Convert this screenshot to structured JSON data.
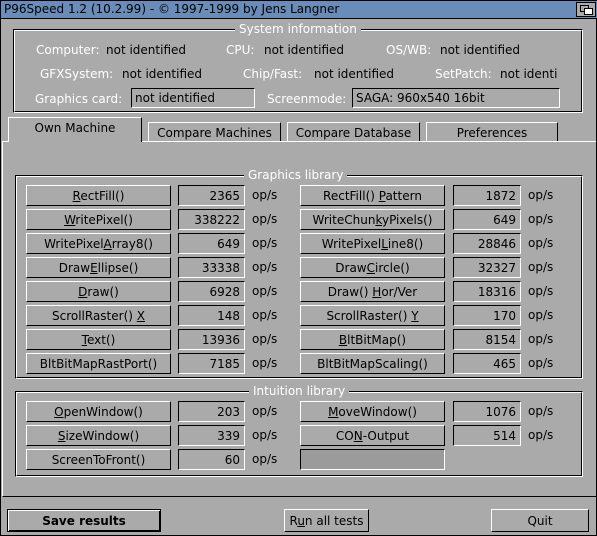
{
  "window": {
    "title": "P96Speed 1.2 (10.2.99) - © 1997-1999 by Jens Langner"
  },
  "system_info": {
    "title": "System information",
    "computer_label": "Computer:",
    "computer_value": "not identified",
    "cpu_label": "CPU:",
    "cpu_value": "not identified",
    "oswb_label": "OS/WB:",
    "oswb_value": "not identified",
    "gfxsystem_label": "GFXSystem:",
    "gfxsystem_value": "not identified",
    "chipfast_label": "Chip/Fast:",
    "chipfast_value": "not identified",
    "setpatch_label": "SetPatch:",
    "setpatch_value": "not identi",
    "graphicscard_label": "Graphics card:",
    "graphicscard_value": "not identified",
    "screenmode_label": "Screenmode:",
    "screenmode_value": "SAGA: 960x540 16bit"
  },
  "tabs": [
    {
      "label": "Own Machine",
      "active": true
    },
    {
      "label": "Compare Machines",
      "active": false
    },
    {
      "label": "Compare Database",
      "active": false
    },
    {
      "label": "Preferences",
      "active": false
    }
  ],
  "graphics": {
    "title": "Graphics library",
    "unit": "op/s",
    "left": [
      {
        "pre": "",
        "u": "R",
        "post": "ectFill()",
        "value": "2365"
      },
      {
        "pre": "",
        "u": "W",
        "post": "ritePixel()",
        "value": "338222"
      },
      {
        "pre": "WritePixel",
        "u": "A",
        "post": "rray8()",
        "value": "649"
      },
      {
        "pre": "Draw",
        "u": "E",
        "post": "llipse()",
        "value": "33338"
      },
      {
        "pre": "",
        "u": "D",
        "post": "raw()",
        "value": "6928"
      },
      {
        "pre": "ScrollRaster() ",
        "u": "X",
        "post": "",
        "value": "148"
      },
      {
        "pre": "",
        "u": "T",
        "post": "ext()",
        "value": "13936"
      },
      {
        "pre": "BltBitMapRastPort()",
        "u": "",
        "post": "",
        "value": "7185"
      }
    ],
    "right": [
      {
        "pre": "RectFill() ",
        "u": "P",
        "post": "attern",
        "value": "1872"
      },
      {
        "pre": "WriteChun",
        "u": "k",
        "post": "yPixels()",
        "value": "649"
      },
      {
        "pre": "WritePixel",
        "u": "L",
        "post": "ine8()",
        "value": "28846"
      },
      {
        "pre": "Draw",
        "u": "C",
        "post": "ircle()",
        "value": "32327"
      },
      {
        "pre": "Draw() ",
        "u": "H",
        "post": "or/Ver",
        "value": "18316"
      },
      {
        "pre": "ScrollRaster() ",
        "u": "Y",
        "post": "",
        "value": "170"
      },
      {
        "pre": "",
        "u": "B",
        "post": "ltBitMap()",
        "value": "8154"
      },
      {
        "pre": "BltBitMapScaling()",
        "u": "",
        "post": "",
        "value": "465"
      }
    ]
  },
  "intuition": {
    "title": "Intuition library",
    "unit": "op/s",
    "left": [
      {
        "pre": "",
        "u": "O",
        "post": "penWindow()",
        "value": "203"
      },
      {
        "pre": "",
        "u": "S",
        "post": "izeWindow()",
        "value": "339"
      },
      {
        "pre": "ScreenToFront()",
        "u": "",
        "post": "",
        "value": "60"
      }
    ],
    "right": [
      {
        "pre": "",
        "u": "M",
        "post": "oveWindow()",
        "value": "1076"
      },
      {
        "pre": "CO",
        "u": "N",
        "post": "-Output",
        "value": "514"
      }
    ]
  },
  "bottom": {
    "save_label": "Save results",
    "run_pre": "R",
    "run_u": "u",
    "run_post": "n all tests",
    "quit_label": "Quit"
  }
}
